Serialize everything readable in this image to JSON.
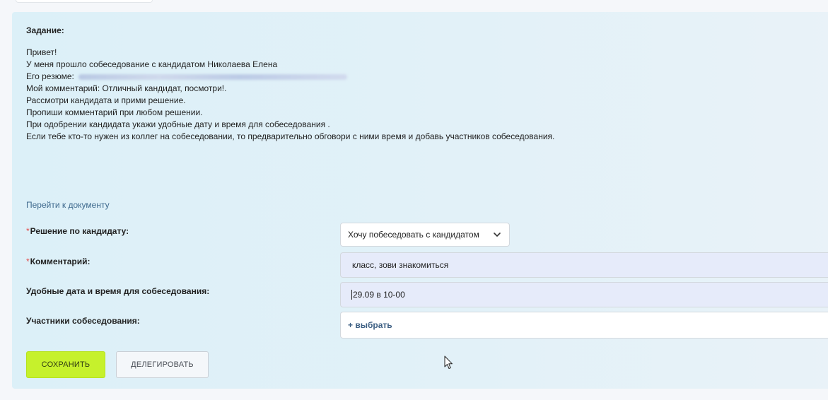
{
  "task": {
    "heading": "Задание:",
    "lines": [
      "Привет!",
      "У меня прошло собеседование с кандидатом Николаева Елена",
      "Его резюме:",
      "Мой комментарий: Отличный кандидат, посмотри!.",
      "Рассмотри кандидата и прими решение.",
      "Пропиши комментарий при любом решении.",
      "При одобрении кандидата укажи удобные дату и время для собеседования .",
      "Если тебе кто-то нужен из коллег на собеседовании, то предварительно обговори с ними время и добавь участников собеседования."
    ]
  },
  "doc_link": "Перейти к документу",
  "form": {
    "required_mark": "*",
    "decision": {
      "label": "Решение по кандидату:",
      "value": "Хочу побеседовать с кандидатом"
    },
    "comment": {
      "label": "Комментарий:",
      "value": "класс, зови знакомиться"
    },
    "datetime": {
      "label": "Удобные дата и время для собеседования:",
      "value": "29.09 в 10-00"
    },
    "participants": {
      "label": "Участники собеседования:",
      "action": "+ выбрать"
    }
  },
  "buttons": {
    "save": "СОХРАНИТЬ",
    "delegate": "ДЕЛЕГИРОВАТЬ"
  },
  "colors": {
    "panel_bg": "#dff0f8",
    "save_bg": "#c6f12c",
    "link": "#3f6a8e",
    "required": "#e24c4c"
  },
  "icons": {
    "dropdown": "chevron-down-icon",
    "pointer": "mouse-cursor-icon"
  }
}
